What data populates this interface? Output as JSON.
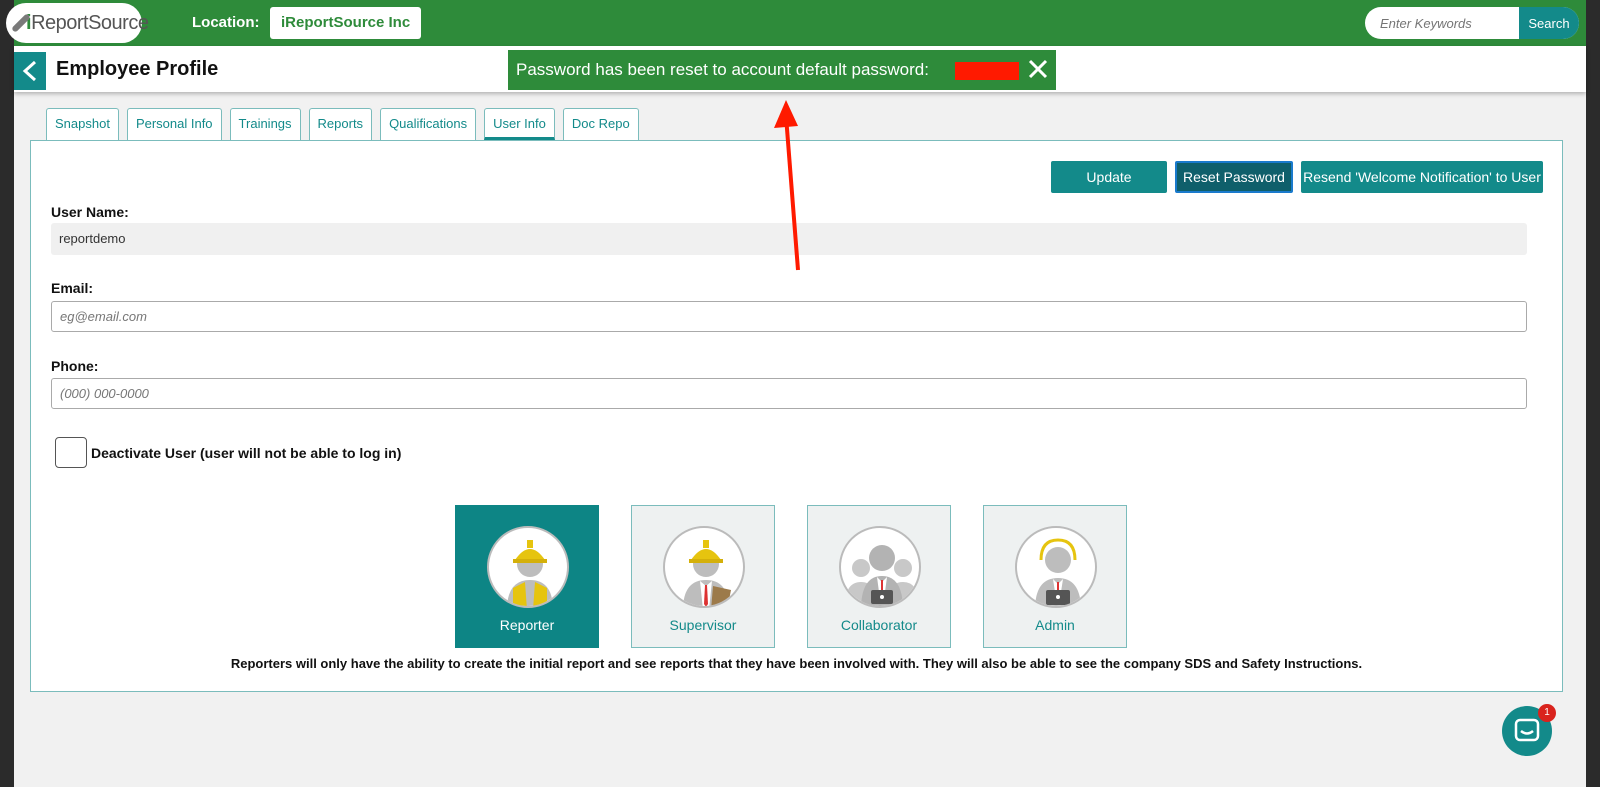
{
  "topbar": {
    "logo_prefix": "i",
    "logo_text": "ReportSource",
    "location_label": "Location:",
    "location_value": "iReportSource Inc",
    "search_placeholder": "Enter Keywords",
    "search_button": "Search"
  },
  "header": {
    "title": "Employee Profile"
  },
  "toast": {
    "message": "Password has been reset to account default password:"
  },
  "tabs": [
    "Snapshot",
    "Personal Info",
    "Trainings",
    "Reports",
    "Qualifications",
    "User Info",
    "Doc Repo"
  ],
  "active_tab": "User Info",
  "actions": {
    "update": "Update",
    "reset_password": "Reset Password",
    "resend": "Resend 'Welcome Notification' to User"
  },
  "form": {
    "username_label": "User Name:",
    "username_value": "reportdemo",
    "email_label": "Email:",
    "email_placeholder": "eg@email.com",
    "phone_label": "Phone:",
    "phone_placeholder": "(000) 000-0000",
    "deactivate_label": "Deactivate User (user will not be able to log in)"
  },
  "roles": [
    {
      "name": "Reporter",
      "icon": "reporter-icon"
    },
    {
      "name": "Supervisor",
      "icon": "supervisor-icon"
    },
    {
      "name": "Collaborator",
      "icon": "collaborator-icon"
    },
    {
      "name": "Admin",
      "icon": "admin-icon"
    }
  ],
  "selected_role": "Reporter",
  "role_description": "Reporters will only have the ability to create the initial report and see reports that they have been involved with. They will also be able to see the company SDS and Safety Instructions.",
  "chat": {
    "badge_count": "1"
  },
  "colors": {
    "brand_green": "#2e8b3a",
    "teal": "#138a8a",
    "annotation_red": "#ff1a00"
  }
}
